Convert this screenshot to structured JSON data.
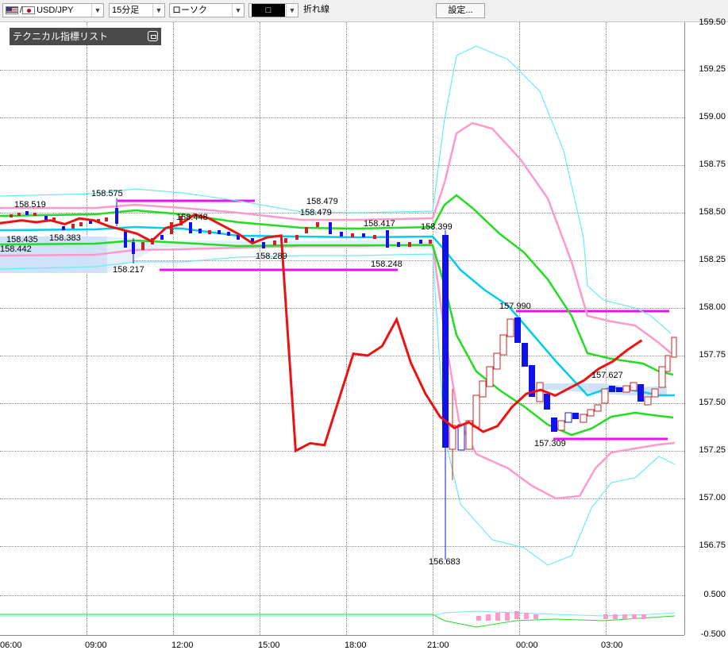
{
  "toolbar": {
    "symbol": "USD/JPY",
    "timeframe": "15分足",
    "chart_style": "ローソク",
    "color_icon": "□",
    "line_type": "折れ線",
    "settings_label": "設定..."
  },
  "panel": {
    "title": "テクニカル指標リスト"
  },
  "colors": {
    "bollinger_inner": "#ff99cc",
    "bollinger_outer": "#66eeee",
    "envelope": "#22dd22",
    "moving_average": "#00ccee",
    "line_chart": "#ee1111",
    "bull_candle": "#cc2222",
    "bear_candle": "#1111ee",
    "horizontal_level": "#ee11ee",
    "cloud": "#cfe2f7"
  },
  "price_labels": {
    "p158519": "158.519",
    "p158575": "158.575",
    "p158435": "158.435",
    "p158383": "158.383",
    "p158442": "158.442",
    "p158217": "158.217",
    "p158448": "158.448",
    "p158479a": "158.479",
    "p158479b": "158.479",
    "p158417": "158.417",
    "p158399": "158.399",
    "p158289": "158.289",
    "p158248": "158.248",
    "p157990": "157.990",
    "p157627": "157.627",
    "p157309": "157.309",
    "p156683": "156.683"
  },
  "chart_data": {
    "type": "line",
    "y_axis_ticks": [
      "159.25",
      "159.00",
      "158.75",
      "158.50",
      "158.25",
      "158.00",
      "157.75",
      "157.50",
      "157.25",
      "157.00",
      "156.75"
    ],
    "y_axis_partial_top": "159.50",
    "oscillator_ticks": [
      "0.500",
      "-0.500"
    ],
    "x_axis_ticks": [
      "06:00",
      "09:00",
      "12:00",
      "15:00",
      "18:00",
      "21:00",
      "00:00",
      "03:00"
    ],
    "x": [
      "05:45",
      "06:15",
      "06:45",
      "07:15",
      "07:45",
      "08:15",
      "08:45",
      "09:15",
      "09:45",
      "10:15",
      "10:45",
      "11:15",
      "11:45",
      "12:15",
      "12:45",
      "13:15",
      "13:45",
      "14:15",
      "14:45",
      "15:15",
      "15:45",
      "16:15",
      "16:45",
      "17:15",
      "17:45",
      "18:15",
      "18:45",
      "19:15",
      "19:45",
      "20:15",
      "20:45",
      "21:15",
      "21:45",
      "22:15",
      "22:45",
      "23:15",
      "23:45",
      "00:15",
      "00:45",
      "01:15",
      "01:45",
      "02:15",
      "02:45",
      "03:15",
      "03:45",
      "04:15"
    ],
    "series": [
      {
        "name": "",
        "values": [
          158.44,
          158.45,
          158.46,
          158.45,
          158.46,
          158.44,
          158.47,
          158.46,
          158.43,
          158.41,
          158.39,
          158.35,
          158.42,
          158.44,
          158.49,
          158.47,
          158.43,
          158.39,
          158.34,
          158.37,
          158.38,
          157.25,
          157.29,
          157.28,
          157.52,
          157.76,
          157.75,
          157.8,
          157.94,
          157.71,
          157.55,
          157.43,
          157.37,
          157.4,
          157.35,
          157.38,
          157.48,
          157.55,
          157.57,
          157.54,
          157.58,
          157.62,
          157.68,
          157.72,
          157.78,
          157.83
        ]
      }
    ],
    "horizontal_levels": [
      158.575,
      158.217,
      157.99,
      157.309
    ],
    "ylim": [
      156.55,
      159.5
    ],
    "grid": true,
    "legend": "none"
  }
}
